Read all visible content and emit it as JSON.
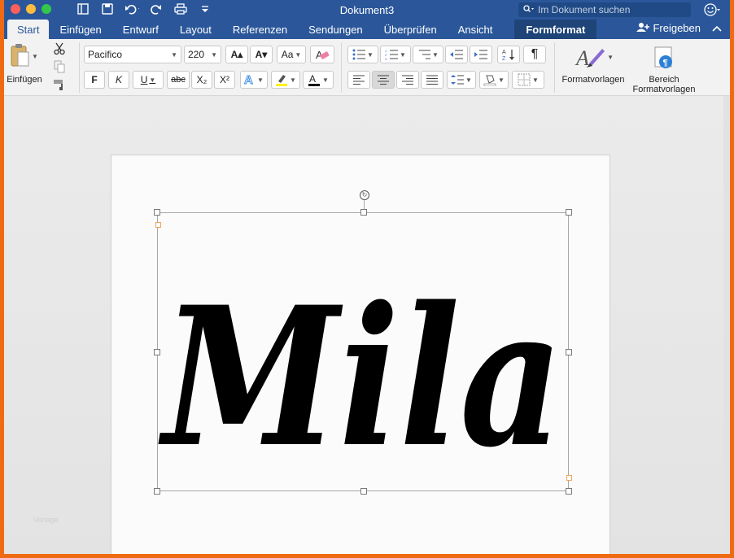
{
  "app": {
    "document_title": "Dokument3",
    "search_placeholder": "Im Dokument suchen",
    "share_label": "Freigeben"
  },
  "colors": {
    "titlebar": "#2b579a",
    "frame_border": "#ef6b13",
    "light_red": "#fc605c",
    "light_yellow": "#fdbc40",
    "light_green": "#34c84a"
  },
  "tabs": [
    {
      "label": "Start",
      "active": true
    },
    {
      "label": "Einfügen"
    },
    {
      "label": "Entwurf"
    },
    {
      "label": "Layout"
    },
    {
      "label": "Referenzen"
    },
    {
      "label": "Sendungen"
    },
    {
      "label": "Überprüfen"
    },
    {
      "label": "Ansicht"
    },
    {
      "label": "Formformat",
      "contextual": true
    }
  ],
  "ribbon": {
    "paste_label": "Einfügen",
    "font_name": "Pacifico",
    "font_size": "220",
    "bold": "F",
    "italic": "K",
    "underline": "U",
    "strike": "abc",
    "subscript": "X₂",
    "superscript": "X²",
    "grow": "A▴",
    "shrink": "A▾",
    "case": "Aa",
    "styles_label": "Formatvorlagen",
    "styles_pane_label_1": "Bereich",
    "styles_pane_label_2": "Formatvorlagen",
    "pilcrow": "¶"
  },
  "document": {
    "wordart_text": "Mila",
    "watermark": "Vorlage"
  },
  "icons": [
    "close-light",
    "minimize-light",
    "zoom-light",
    "sidebar-icon",
    "save-icon",
    "undo-icon",
    "redo-icon",
    "print-icon",
    "customize-icon",
    "search-icon",
    "smiley-icon",
    "add-person-icon",
    "chevron-up-icon",
    "clipboard-icon",
    "scissors-icon",
    "copy-icon",
    "format-painter-icon",
    "eraser-icon",
    "text-effects-icon",
    "highlighter-icon",
    "font-color-icon",
    "bullets-icon",
    "numbering-icon",
    "multilevel-icon",
    "outdent-icon",
    "indent-icon",
    "sort-icon",
    "pilcrow-icon",
    "align-left-icon",
    "align-center-icon",
    "align-right-icon",
    "justify-icon",
    "line-spacing-icon",
    "shading-icon",
    "borders-icon",
    "styles-icon",
    "styles-pane-icon",
    "rotate-icon"
  ]
}
